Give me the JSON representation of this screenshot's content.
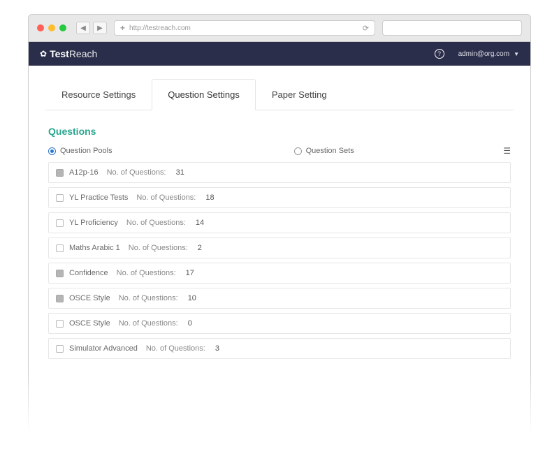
{
  "browser": {
    "url": "http://testreach.com"
  },
  "header": {
    "brand_prefix": "Test",
    "brand_suffix": "Reach",
    "user_label": "admin@org.com"
  },
  "tabs": [
    {
      "label": "Resource Settings",
      "active": false
    },
    {
      "label": "Question Settings",
      "active": true
    },
    {
      "label": "Paper Setting",
      "active": false
    }
  ],
  "section_title": "Questions",
  "filters": {
    "pools_label": "Question Pools",
    "sets_label": "Question Sets",
    "selected": "pools"
  },
  "count_label": "No. of Questions:",
  "pools": [
    {
      "name": "A12p-16",
      "count": "31",
      "checked": true
    },
    {
      "name": "YL Practice Tests",
      "count": "18",
      "checked": false
    },
    {
      "name": "YL Proficiency",
      "count": "14",
      "checked": false
    },
    {
      "name": "Maths Arabic 1",
      "count": "2",
      "checked": false
    },
    {
      "name": "Confidence",
      "count": "17",
      "checked": true
    },
    {
      "name": "OSCE Style",
      "count": "10",
      "checked": true
    },
    {
      "name": "OSCE Style",
      "count": "0",
      "checked": false
    },
    {
      "name": "Simulator Advanced",
      "count": "3",
      "checked": false
    }
  ]
}
